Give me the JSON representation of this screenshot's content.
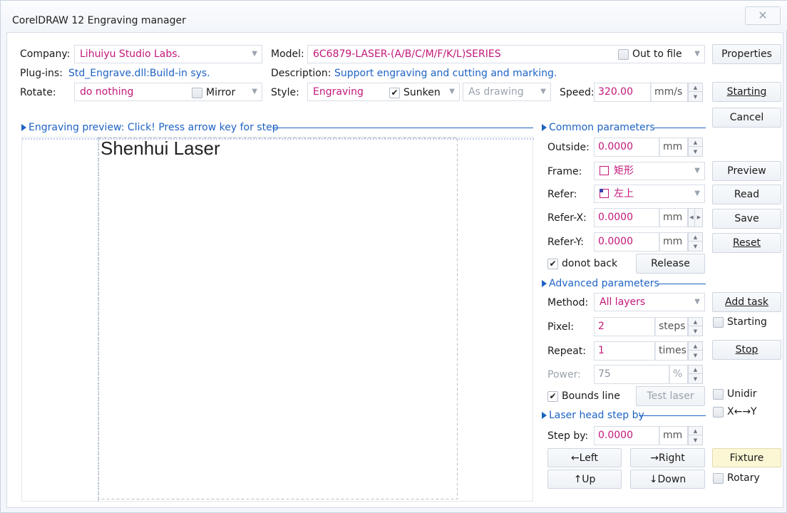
{
  "window": {
    "title": "CorelDRAW 12 Engraving manager",
    "close_glyph": "✕"
  },
  "top": {
    "company_label": "Company:",
    "company_value": "Lihuiyu Studio Labs.",
    "model_label": "Model:",
    "model_value": "6C6879-LASER-(A/B/C/M/F/K/L)SERIES",
    "out_to_file_label": "Out to file",
    "out_to_file_checked": false,
    "plugins_label": "Plug-ins:",
    "plugins_value": "Std_Engrave.dll:Build-in sys.",
    "description_label": "Description:",
    "description_value": "Support engraving and cutting and marking.",
    "rotate_label": "Rotate:",
    "rotate_value": "do nothing",
    "mirror_label": "Mirror",
    "mirror_checked": false,
    "style_label": "Style:",
    "style_value": "Engraving",
    "sunken_label": "Sunken",
    "sunken_checked": true,
    "as_drawing_value": "As drawing",
    "speed_label": "Speed:",
    "speed_value": "320.00",
    "speed_unit": "mm/s"
  },
  "right_buttons": {
    "properties": "Properties",
    "starting": "Starting",
    "cancel": "Cancel",
    "preview": "Preview",
    "read": "Read",
    "save": "Save",
    "reset": "Reset",
    "add_task": "Add task",
    "starting_check": "Starting",
    "stop": "Stop",
    "unidir": "Unidir",
    "xy": "X←→Y",
    "fixture": "Fixture",
    "rotary": "Rotary"
  },
  "preview_panel": {
    "header": "Engraving preview: Click! Press arrow key for step",
    "text": "Shenhui Laser"
  },
  "common": {
    "header": "Common parameters",
    "outside_label": "Outside:",
    "outside_value": "0.0000",
    "outside_unit": "mm",
    "frame_label": "Frame:",
    "frame_value": "矩形",
    "refer_label": "Refer:",
    "refer_value": "左上",
    "refer_x_label": "Refer-X:",
    "refer_x_value": "0.0000",
    "refer_x_unit": "mm",
    "refer_y_label": "Refer-Y:",
    "refer_y_value": "0.0000",
    "refer_y_unit": "mm",
    "donot_back_label": "donot back",
    "donot_back_checked": true,
    "release": "Release"
  },
  "advanced": {
    "header": "Advanced parameters",
    "method_label": "Method:",
    "method_value": "All layers",
    "pixel_label": "Pixel:",
    "pixel_value": "2",
    "pixel_unit": "steps",
    "repeat_label": "Repeat:",
    "repeat_value": "1",
    "repeat_unit": "times",
    "power_label": "Power:",
    "power_value": "75",
    "power_unit": "%",
    "bounds_line_label": "Bounds line",
    "bounds_line_checked": true,
    "test_laser": "Test laser"
  },
  "step": {
    "header": "Laser head step by",
    "step_by_label": "Step by:",
    "step_by_value": "0.0000",
    "step_by_unit": "mm",
    "left": "←Left",
    "right": "→Right",
    "up": "↑Up",
    "down": "↓Down"
  }
}
